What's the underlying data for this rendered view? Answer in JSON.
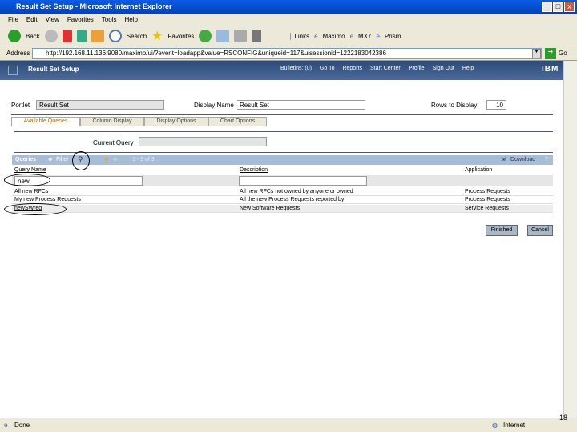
{
  "window": {
    "title": "Result Set Setup - Microsoft Internet Explorer"
  },
  "menu": [
    "File",
    "Edit",
    "View",
    "Favorites",
    "Tools",
    "Help"
  ],
  "toolbar": {
    "back": "Back",
    "search": "Search",
    "favorites": "Favorites",
    "links": "Links",
    "link_items": [
      "Maximo",
      "MX7",
      "Prism"
    ]
  },
  "address": {
    "label": "Address",
    "url": "http://192.168.11.136:9080/maximo/ui/?event=loadapp&value=RSCONFIG&uniqueid=117&uisessionid=1222183042386",
    "go": "Go"
  },
  "app": {
    "title": "Result Set Setup",
    "nav": [
      "Bulletins: (0)",
      "Go To",
      "Reports",
      "Start Center",
      "Profile",
      "Sign Out",
      "Help"
    ],
    "logo": "IBM"
  },
  "form": {
    "portlet_label": "Portlet",
    "portlet_value": "Result Set",
    "display_name_label": "Display Name",
    "display_name_value": "Result Set",
    "rows_label": "Rows to Display",
    "rows_value": "10",
    "current_query_label": "Current Query",
    "current_query_value": ""
  },
  "tabs": [
    "Available Queries",
    "Column Display",
    "Display Options",
    "Chart Options"
  ],
  "queries": {
    "title": "Queries",
    "filter": "Filter",
    "pager": "1 - 3 of 3",
    "download": "Download",
    "columns": [
      "Query Name",
      "Description",
      "Application"
    ],
    "filter_values": [
      "new",
      ""
    ],
    "rows": [
      {
        "name": "All new RFCs",
        "description": "All new RFCs not owned by anyone or owned",
        "application": "Process Requests"
      },
      {
        "name": "My new Process Requests",
        "description": "All the new Process Requests reported by",
        "application": "Process Requests"
      },
      {
        "name": "newSWreq",
        "description": "New Software Requests",
        "application": "Service Requests"
      }
    ]
  },
  "buttons": {
    "finished": "Finished",
    "cancel": "Cancel"
  },
  "status": {
    "text": "Done",
    "zone": "Internet",
    "page": "18"
  }
}
